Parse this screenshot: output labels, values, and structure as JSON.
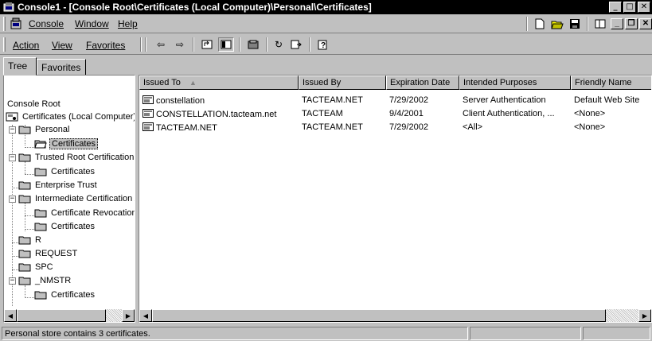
{
  "window": {
    "title": "Console1 - [Console Root\\Certificates (Local Computer)\\Personal\\Certificates]",
    "controls": {
      "minimize": "_",
      "maximize": "□",
      "close": "✕"
    }
  },
  "menubar": {
    "items": [
      {
        "label": "Console"
      },
      {
        "label": "Window"
      },
      {
        "label": "Help"
      }
    ],
    "icons": [
      "new-document-icon",
      "open-folder-icon",
      "save-icon",
      "properties-icon"
    ],
    "mdi_controls": {
      "minimize": "_",
      "restore": "❐",
      "close": "✕"
    }
  },
  "toolbar": {
    "menus": [
      {
        "label": "Action"
      },
      {
        "label": "View"
      },
      {
        "label": "Favorites"
      }
    ],
    "glyphs": {
      "back": "⇦",
      "forward": "⇨",
      "up": "⤴",
      "show_tree": "▦",
      "delete": "▣",
      "refresh": "↻",
      "export": "⇶",
      "help": "?"
    }
  },
  "tabs": [
    {
      "label": "Tree",
      "active": true
    },
    {
      "label": "Favorites",
      "active": false
    }
  ],
  "tree": {
    "items": [
      {
        "label": "Console Root"
      },
      {
        "label": "Certificates (Local Computer)"
      },
      {
        "label": "Personal"
      },
      {
        "label": "Certificates",
        "selected": true
      },
      {
        "label": "Trusted Root Certification Authorities"
      },
      {
        "label": "Certificates"
      },
      {
        "label": "Enterprise Trust"
      },
      {
        "label": "Intermediate Certification Authorities"
      },
      {
        "label": "Certificate Revocation List"
      },
      {
        "label": "Certificates"
      },
      {
        "label": "R"
      },
      {
        "label": "REQUEST"
      },
      {
        "label": "SPC"
      },
      {
        "label": "_NMSTR"
      },
      {
        "label": "Certificates"
      }
    ],
    "expander_minus": "−"
  },
  "list": {
    "columns": [
      {
        "label": "Issued To",
        "sort_glyph": "▲"
      },
      {
        "label": "Issued By"
      },
      {
        "label": "Expiration Date"
      },
      {
        "label": "Intended Purposes"
      },
      {
        "label": "Friendly Name"
      }
    ],
    "rows": [
      {
        "issued_to": "constellation",
        "issued_by": "TACTEAM.NET",
        "expiration": "7/29/2002",
        "purposes": "Server Authentication",
        "friendly": "Default Web Site"
      },
      {
        "issued_to": "CONSTELLATION.tacteam.net",
        "issued_by": "TACTEAM",
        "expiration": "9/4/2001",
        "purposes": "Client Authentication, ...",
        "friendly": "<None>"
      },
      {
        "issued_to": "TACTEAM.NET",
        "issued_by": "TACTEAM.NET",
        "expiration": "7/29/2002",
        "purposes": "<All>",
        "friendly": "<None>"
      }
    ]
  },
  "scroll": {
    "left": "◀",
    "right": "▶"
  },
  "status": {
    "text": "Personal store contains 3 certificates."
  }
}
